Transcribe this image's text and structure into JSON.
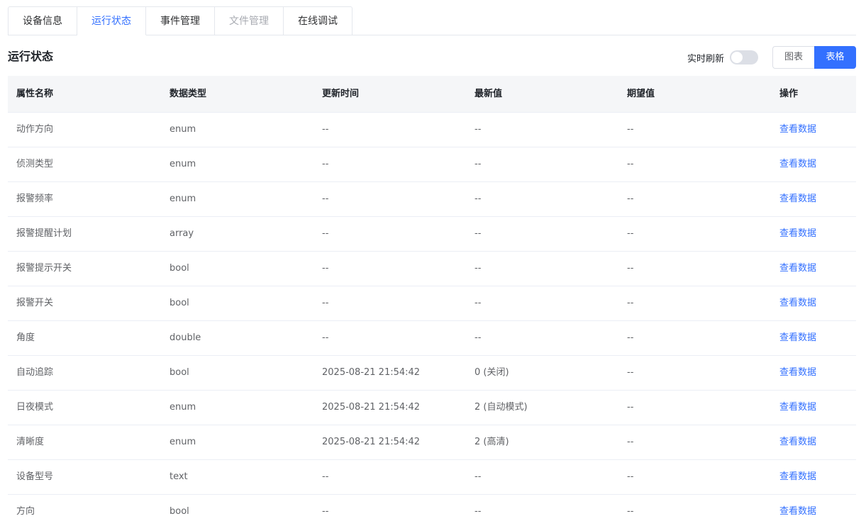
{
  "tabs": [
    {
      "label": "设备信息",
      "state": "normal"
    },
    {
      "label": "运行状态",
      "state": "active"
    },
    {
      "label": "事件管理",
      "state": "normal"
    },
    {
      "label": "文件管理",
      "state": "disabled"
    },
    {
      "label": "在线调试",
      "state": "normal"
    }
  ],
  "section_title": "运行状态",
  "toolbar": {
    "refresh_label": "实时刷新",
    "refresh_enabled": false,
    "chart_view_label": "图表",
    "table_view_label": "表格",
    "active_view": "表格"
  },
  "table": {
    "columns": [
      "属性名称",
      "数据类型",
      "更新时间",
      "最新值",
      "期望值",
      "操作"
    ],
    "rows": [
      {
        "name": "动作方向",
        "type": "enum",
        "updated": "--",
        "latest": "--",
        "expected": "--",
        "action": "查看数据"
      },
      {
        "name": "侦测类型",
        "type": "enum",
        "updated": "--",
        "latest": "--",
        "expected": "--",
        "action": "查看数据"
      },
      {
        "name": "报警频率",
        "type": "enum",
        "updated": "--",
        "latest": "--",
        "expected": "--",
        "action": "查看数据"
      },
      {
        "name": "报警提醒计划",
        "type": "array",
        "updated": "--",
        "latest": "--",
        "expected": "--",
        "action": "查看数据"
      },
      {
        "name": "报警提示开关",
        "type": "bool",
        "updated": "--",
        "latest": "--",
        "expected": "--",
        "action": "查看数据"
      },
      {
        "name": "报警开关",
        "type": "bool",
        "updated": "--",
        "latest": "--",
        "expected": "--",
        "action": "查看数据"
      },
      {
        "name": "角度",
        "type": "double",
        "updated": "--",
        "latest": "--",
        "expected": "--",
        "action": "查看数据"
      },
      {
        "name": "自动追踪",
        "type": "bool",
        "updated": "2025-08-21 21:54:42",
        "latest": "0 (关闭)",
        "expected": "--",
        "action": "查看数据"
      },
      {
        "name": "日夜模式",
        "type": "enum",
        "updated": "2025-08-21 21:54:42",
        "latest": "2 (自动模式)",
        "expected": "--",
        "action": "查看数据"
      },
      {
        "name": "清晰度",
        "type": "enum",
        "updated": "2025-08-21 21:54:42",
        "latest": "2 (高清)",
        "expected": "--",
        "action": "查看数据"
      },
      {
        "name": "设备型号",
        "type": "text",
        "updated": "--",
        "latest": "--",
        "expected": "--",
        "action": "查看数据"
      },
      {
        "name": "方向",
        "type": "bool",
        "updated": "--",
        "latest": "--",
        "expected": "--",
        "action": "查看数据"
      }
    ]
  },
  "colors": {
    "accent": "#3370ff",
    "header_bg": "#f5f6f8",
    "border": "#ebeef5"
  }
}
